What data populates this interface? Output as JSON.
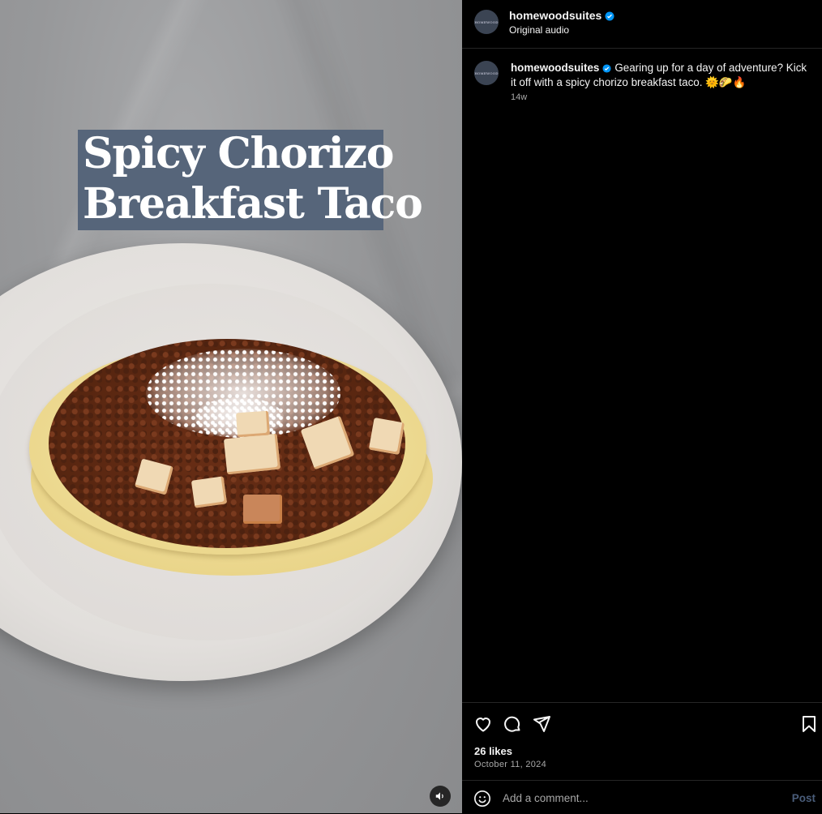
{
  "media": {
    "title_line1": "Spicy Chorizo",
    "title_line2": "Breakfast Taco",
    "volume_icon": "speaker-icon"
  },
  "header": {
    "username": "homewoodsuites",
    "audio": "Original audio",
    "avatar_text": "HOMEWOOD"
  },
  "caption": {
    "username": "homewoodsuites",
    "text": "Gearing up for a day of adventure? Kick it off with a spicy chorizo breakfast taco. 🌞🌮🔥",
    "time": "14w"
  },
  "actions": {
    "icons": [
      "heart-icon",
      "comment-icon",
      "share-icon",
      "bookmark-icon"
    ],
    "likes": "26 likes",
    "date": "October 11, 2024"
  },
  "comment": {
    "placeholder": "Add a comment...",
    "post_label": "Post"
  },
  "colors": {
    "verified": "#0095f6",
    "title_box": "#56657a",
    "post_disabled": "#4a5d7a"
  }
}
